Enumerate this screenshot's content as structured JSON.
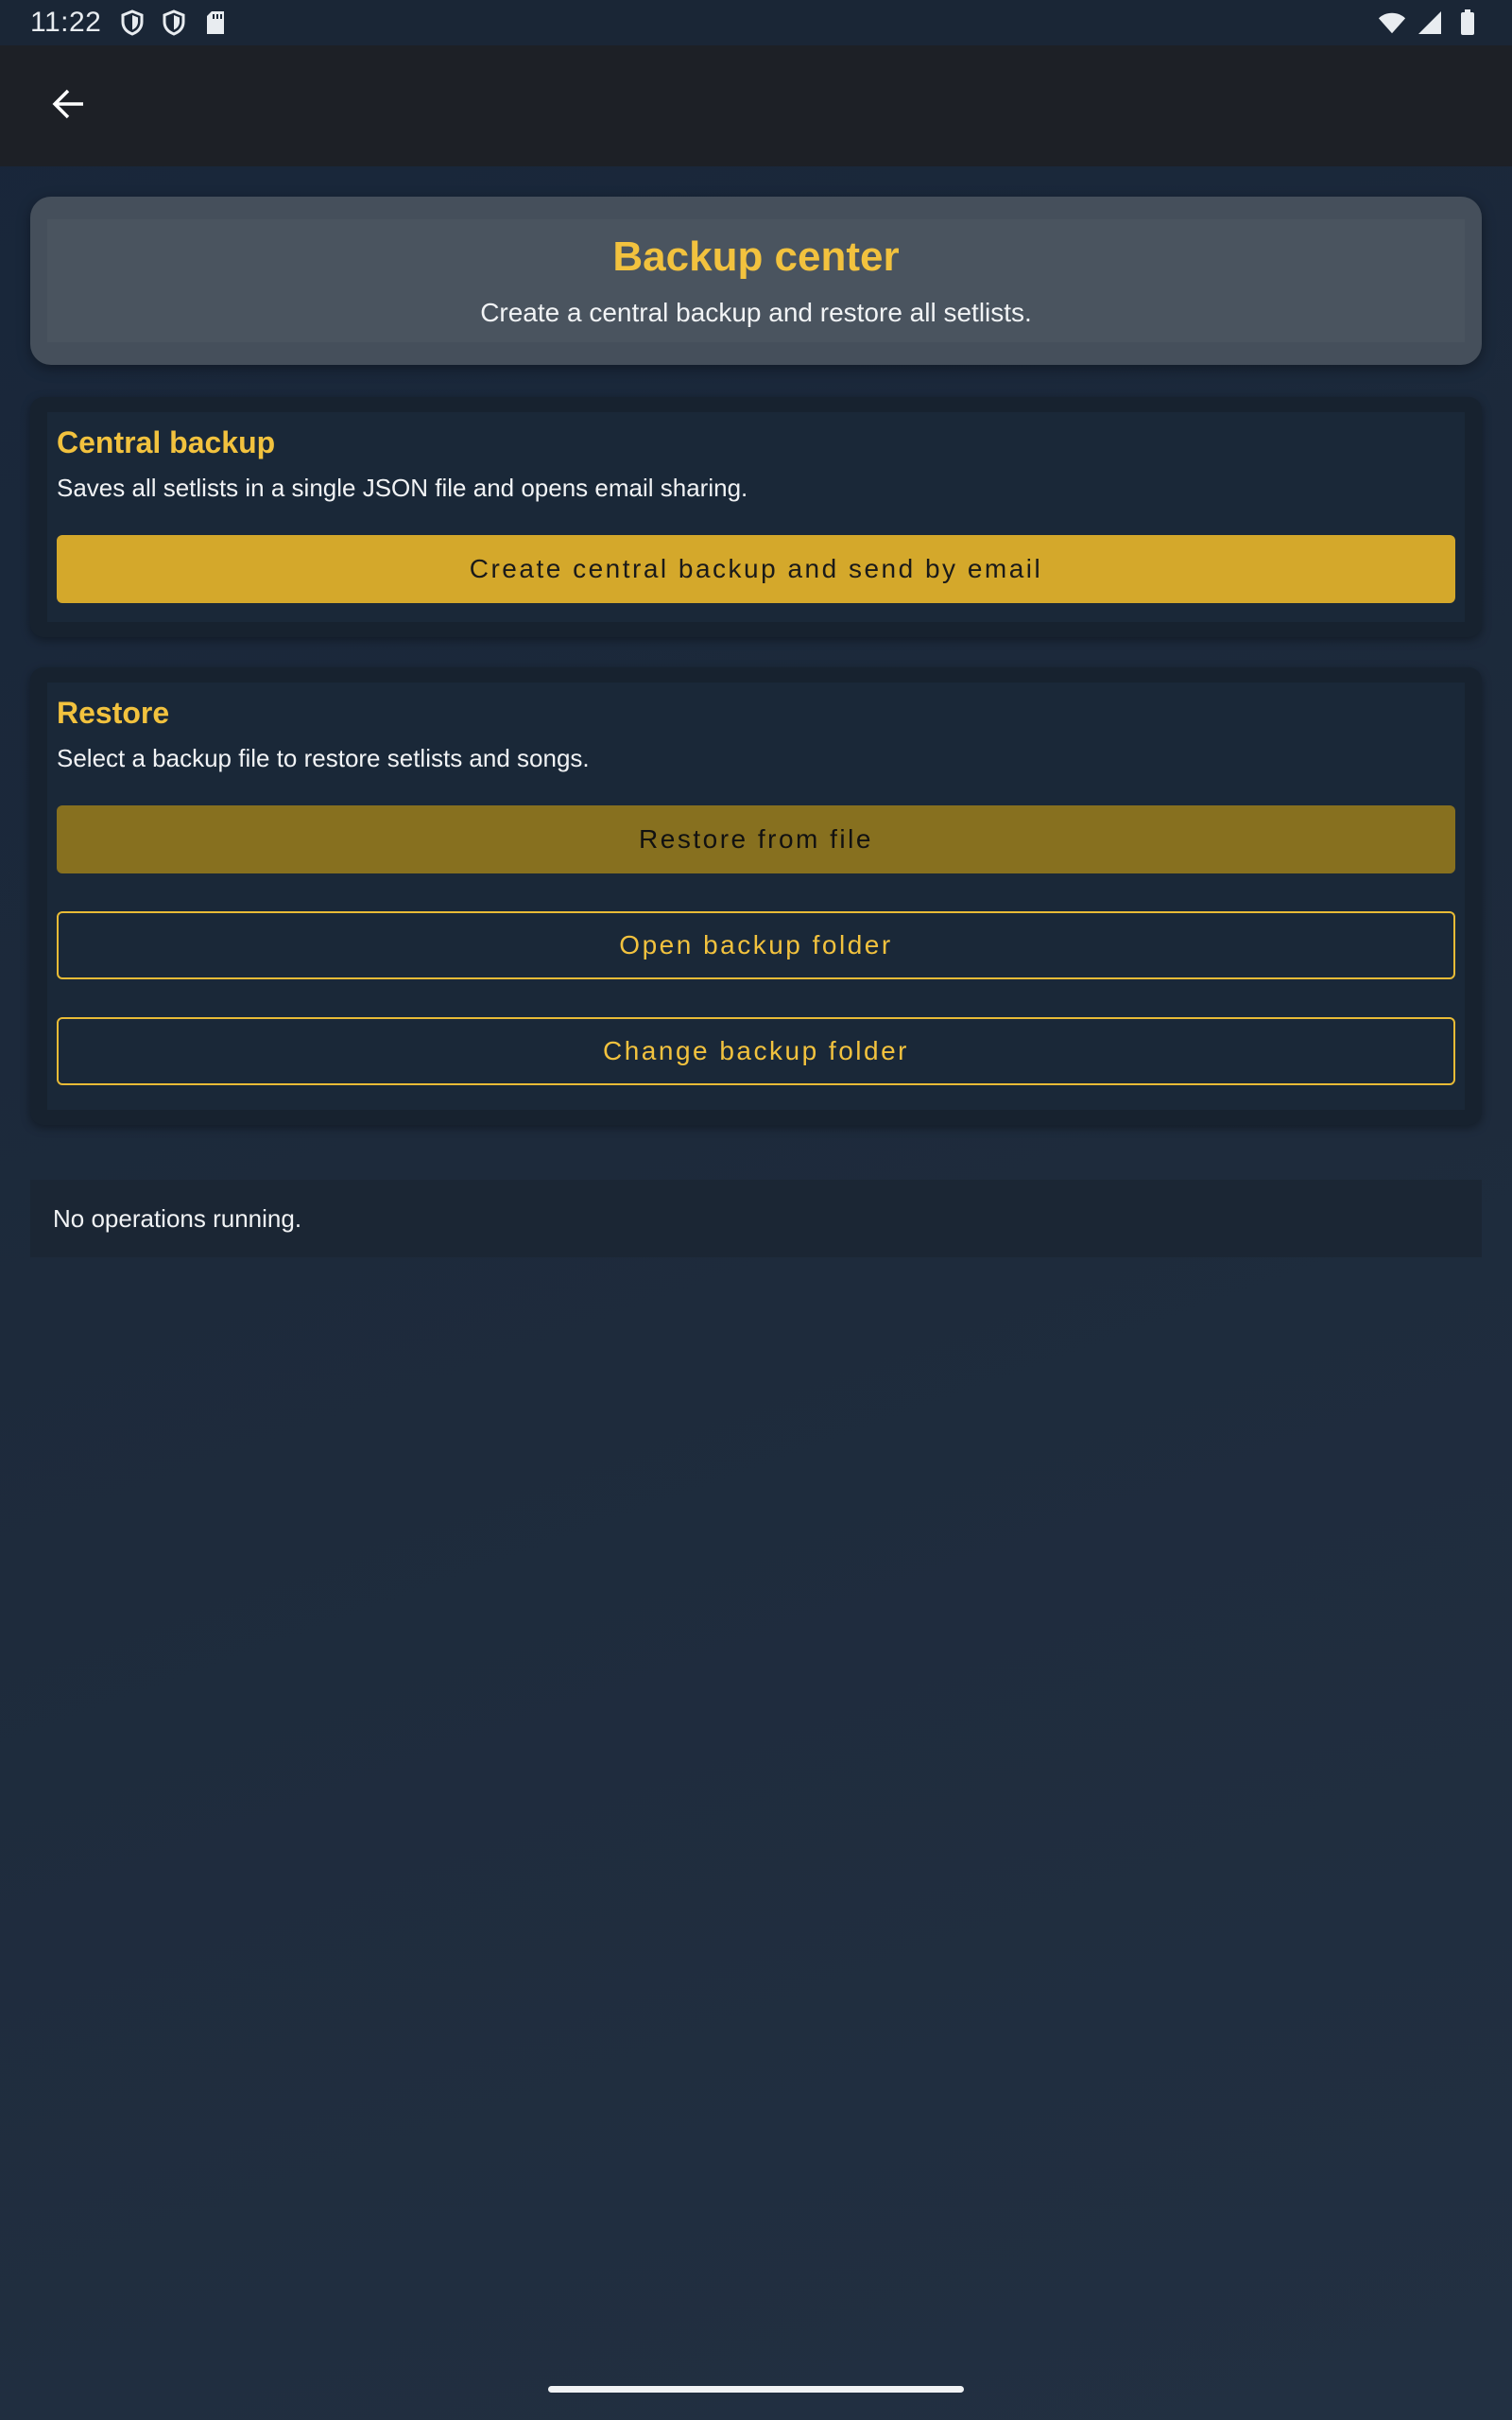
{
  "status_bar": {
    "time": "11:22",
    "left_icons": [
      "shield-icon",
      "shield-icon",
      "sd-card-icon"
    ],
    "right_icons": [
      "wifi-icon",
      "signal-icon",
      "battery-icon"
    ]
  },
  "app_bar": {
    "back_icon": "arrow-left-icon"
  },
  "header": {
    "title": "Backup center",
    "subtitle": "Create a central backup and restore all setlists."
  },
  "central_backup": {
    "title": "Central backup",
    "description": "Saves all setlists in a single JSON file and opens email sharing.",
    "button_label": "Create central backup and send by email"
  },
  "restore": {
    "title": "Restore",
    "description": "Select a backup file to restore setlists and songs.",
    "restore_button_label": "Restore from file",
    "open_folder_label": "Open backup folder",
    "change_folder_label": "Change backup folder"
  },
  "operations": {
    "status_text": "No operations running."
  },
  "colors": {
    "accent": "#f2c23e",
    "button_fill": "#d4a82b",
    "button_fill_disabled": "#87701f",
    "background": "#1d2a3b",
    "app_bar": "#1d2026"
  }
}
